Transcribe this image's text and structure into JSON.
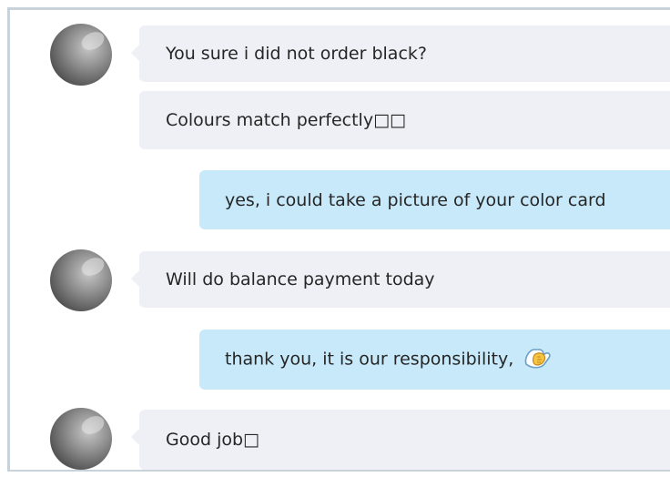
{
  "messages": [
    {
      "direction": "incoming",
      "text": "You sure i did not order black?"
    },
    {
      "direction": "incoming",
      "text": "Colours match perfectly□□"
    },
    {
      "direction": "outgoing",
      "text": "yes, i could take a picture of your color card"
    },
    {
      "direction": "incoming",
      "text": "Will do balance payment today"
    },
    {
      "direction": "outgoing",
      "text": "thank you, it is our responsibility,",
      "emoji": "clapping-hands-icon"
    },
    {
      "direction": "incoming",
      "text": "Good job□"
    }
  ],
  "colors": {
    "incoming_bubble": "#eef0f5",
    "outgoing_bubble": "#c7e9fa",
    "text": "#262626",
    "frame_border": "#c9d1d9"
  }
}
